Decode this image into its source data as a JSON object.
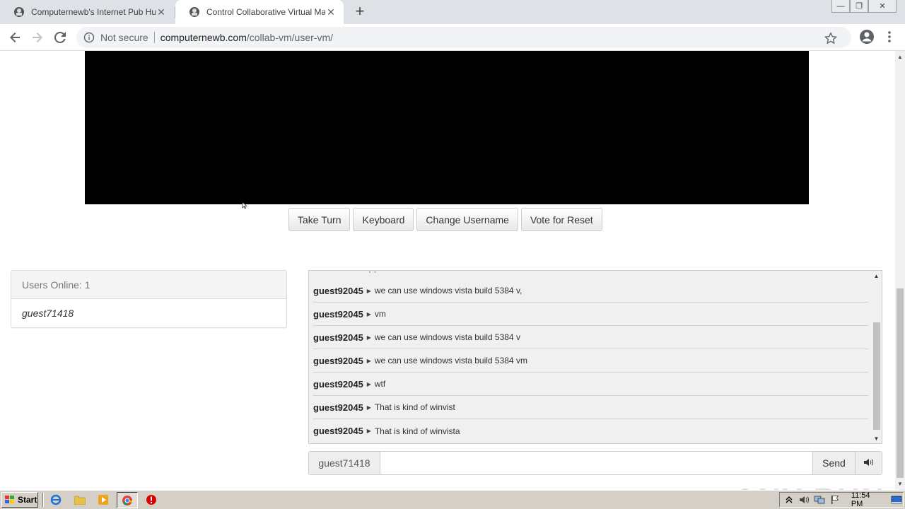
{
  "browser": {
    "tabs": [
      {
        "title": "Computernewb's Internet Pub Hub",
        "active": false
      },
      {
        "title": "Control Collaborative Virtual Machine",
        "active": true
      }
    ],
    "new_tab_symbol": "+",
    "address": {
      "security_label": "Not secure",
      "host": "computernewb.com",
      "path": "/collab-vm/user-vm/"
    },
    "icons": [
      "back-icon",
      "forward-icon",
      "reload-icon",
      "info-icon",
      "star-icon",
      "profile-icon",
      "kebab-menu-icon"
    ]
  },
  "vm": {
    "buttons": {
      "take_turn": "Take Turn",
      "keyboard": "Keyboard",
      "change_username": "Change Username",
      "vote_reset": "Vote for Reset"
    }
  },
  "users": {
    "heading": "Users Online: 1",
    "list": [
      "guest71418"
    ]
  },
  "chat": {
    "top_fragment": "· ·",
    "messages": [
      {
        "user": "guest92045",
        "text": "we can use windows vista build 5384 v,"
      },
      {
        "user": "guest92045",
        "text": "vm"
      },
      {
        "user": "guest92045",
        "text": "we can use windows vista build 5384 v"
      },
      {
        "user": "guest92045",
        "text": "we can use windows vista build 5384 vm"
      },
      {
        "user": "guest92045",
        "text": "wtf"
      },
      {
        "user": "guest92045",
        "text": "That is kind of winvist"
      },
      {
        "user": "guest92045",
        "text": "That is kind of winvista"
      }
    ],
    "username_label": "guest71418",
    "input_value": "",
    "send_label": "Send"
  },
  "watermark": "ANY RUN",
  "taskbar": {
    "start_label": "Start",
    "clock": "11:54 PM",
    "icons": [
      "ie-icon",
      "explorer-folder-icon",
      "media-player-icon",
      "chrome-icon",
      "stop-icon"
    ]
  },
  "colors": {
    "vm_screen": "#000000",
    "panel_heading_bg": "#f5f5f5",
    "chat_bg": "#f0f0f0",
    "taskbar": "#d4d0c8"
  }
}
